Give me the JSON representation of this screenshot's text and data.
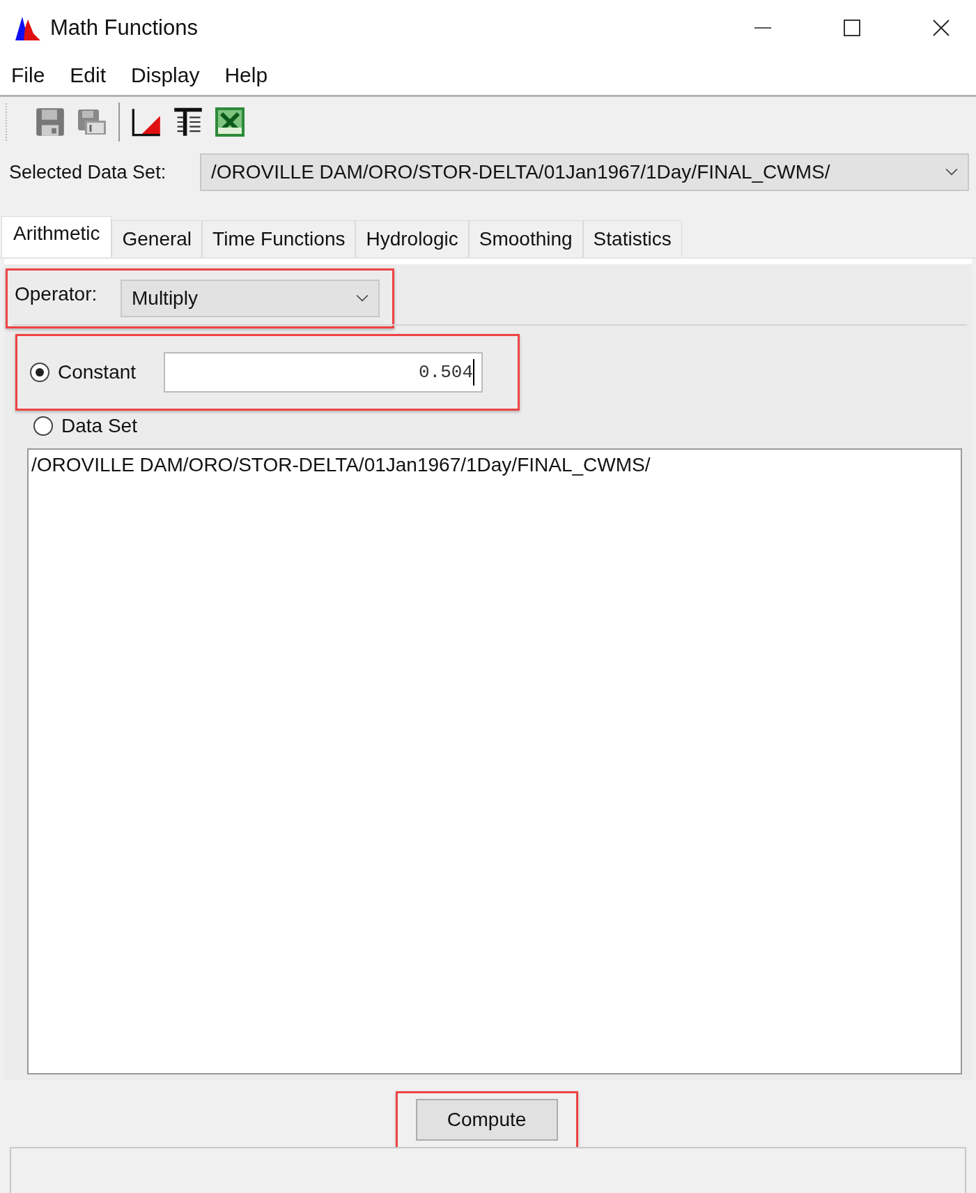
{
  "window": {
    "title": "Math Functions"
  },
  "menu": [
    "File",
    "Edit",
    "Display",
    "Help"
  ],
  "selected_data_set": {
    "label": "Selected Data Set:",
    "value": "/OROVILLE DAM/ORO/STOR-DELTA/01Jan1967/1Day/FINAL_CWMS/"
  },
  "tabs": [
    {
      "label": "Arithmetic",
      "selected": true
    },
    {
      "label": "General",
      "selected": false
    },
    {
      "label": "Time Functions",
      "selected": false
    },
    {
      "label": "Hydrologic",
      "selected": false
    },
    {
      "label": "Smoothing",
      "selected": false
    },
    {
      "label": "Statistics",
      "selected": false
    }
  ],
  "operator": {
    "label": "Operator:",
    "value": "Multiply",
    "highlighted": true
  },
  "constant": {
    "label": "Constant",
    "selected": true,
    "value": "0.504",
    "highlighted": true
  },
  "data_set": {
    "label": "Data Set",
    "selected": false,
    "list": [
      "/OROVILLE DAM/ORO/STOR-DELTA/01Jan1967/1Day/FINAL_CWMS/"
    ]
  },
  "compute_button": {
    "label": "Compute",
    "highlighted": true
  }
}
